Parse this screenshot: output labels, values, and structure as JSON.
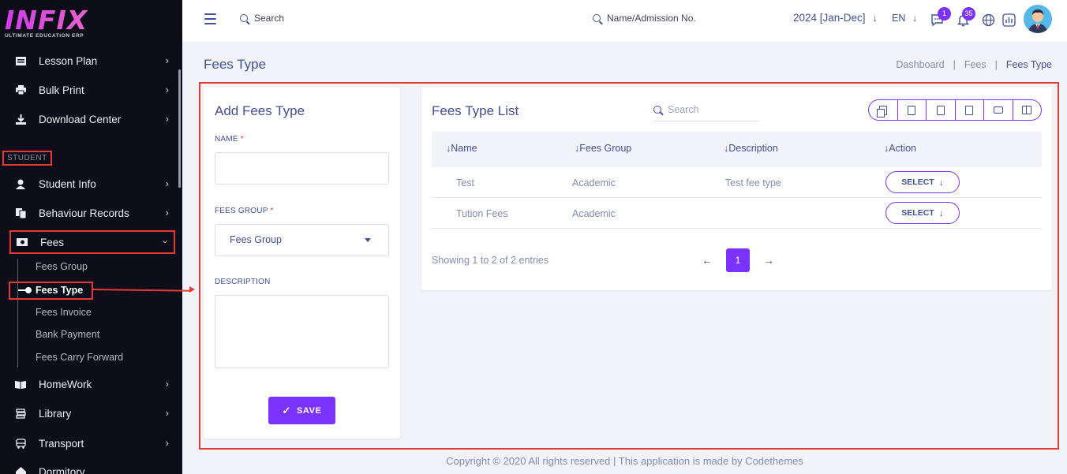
{
  "brand": {
    "name": "INFIX",
    "tagline": "ULTIMATE EDUCATION ERP"
  },
  "sidebar": {
    "items_top": [
      {
        "label": "Lesson Plan"
      },
      {
        "label": "Bulk Print"
      },
      {
        "label": "Download Center"
      }
    ],
    "section_label": "STUDENT",
    "items_student": [
      {
        "label": "Student Info"
      },
      {
        "label": "Behaviour Records"
      },
      {
        "label": "Fees"
      }
    ],
    "fees_sub": [
      {
        "label": "Fees Group"
      },
      {
        "label": "Fees Type"
      },
      {
        "label": "Fees Invoice"
      },
      {
        "label": "Bank Payment"
      },
      {
        "label": "Fees Carry Forward"
      }
    ],
    "items_bottom": [
      {
        "label": "HomeWork"
      },
      {
        "label": "Library"
      },
      {
        "label": "Transport"
      },
      {
        "label": "Dormitory"
      }
    ]
  },
  "topbar": {
    "search_placeholder": "Search",
    "search2_placeholder": "Name/Admission No.",
    "academic_year": "2024 [Jan-Dec]",
    "language": "EN",
    "chat_badge": "1",
    "notification_badge": "35"
  },
  "page": {
    "title": "Fees Type",
    "breadcrumb": [
      "Dashboard",
      "Fees",
      "Fees Type"
    ]
  },
  "form": {
    "title": "Add Fees Type",
    "name_label": "NAME",
    "required_mark": "*",
    "group_label": "FEES GROUP",
    "group_value": "Fees Group",
    "description_label": "DESCRIPTION",
    "save_label": "SAVE"
  },
  "list": {
    "title": "Fees Type List",
    "search_placeholder": "Search",
    "columns": [
      "Name",
      "Fees Group",
      "Description",
      "Action"
    ],
    "rows": [
      {
        "name": "Test",
        "group": "Academic",
        "description": "Test fee type",
        "action": "SELECT"
      },
      {
        "name": "Tution Fees",
        "group": "Academic",
        "description": "",
        "action": "SELECT"
      }
    ],
    "showing": "Showing 1 to 2 of 2 entries",
    "current_page": "1"
  },
  "footer": {
    "text": "Copyright © 2020 All rights reserved | This application is made by Codethemes"
  },
  "colors": {
    "accent": "#7c32ff",
    "highlight": "#e53935",
    "text": "#415094",
    "sidebar": "#0e0e1a"
  }
}
